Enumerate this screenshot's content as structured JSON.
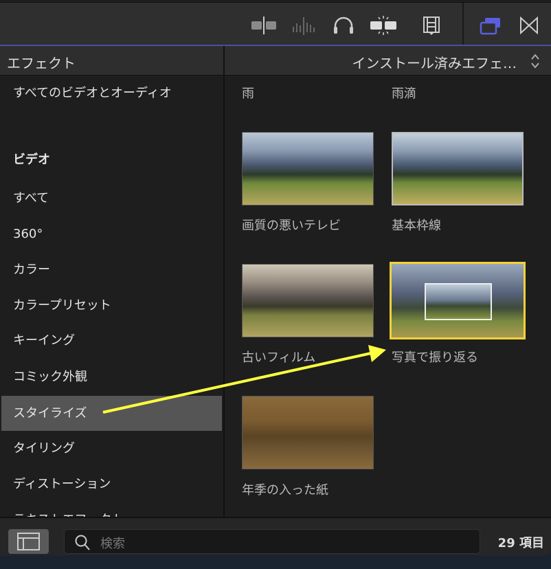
{
  "header": {
    "title": "エフェクト",
    "category_select": "インストール済みエフェ…"
  },
  "sidebar": {
    "items": [
      {
        "label": "すべてのビデオとオーディオ"
      },
      {
        "label": "ビデオ"
      },
      {
        "label": "すべて"
      },
      {
        "label": "360°"
      },
      {
        "label": "カラー"
      },
      {
        "label": "カラープリセット"
      },
      {
        "label": "キーイング"
      },
      {
        "label": "コミック外観"
      },
      {
        "label": "スタイライズ"
      },
      {
        "label": "タイリング"
      },
      {
        "label": "ディストーション"
      },
      {
        "label": "テキストエフェクト"
      }
    ]
  },
  "effects": [
    {
      "label": "雨"
    },
    {
      "label": "雨滴"
    },
    {
      "label": "画質の悪いテレビ"
    },
    {
      "label": "基本枠線"
    },
    {
      "label": "古いフィルム"
    },
    {
      "label": "写真で振り返る"
    },
    {
      "label": "年季の入った紙"
    }
  ],
  "search": {
    "placeholder": "検索"
  },
  "footer": {
    "count": "29 項目"
  },
  "colors": {
    "accent": "#5a5fe0",
    "selection": "#f2d23a",
    "annotation_arrow": "#ffff40"
  }
}
